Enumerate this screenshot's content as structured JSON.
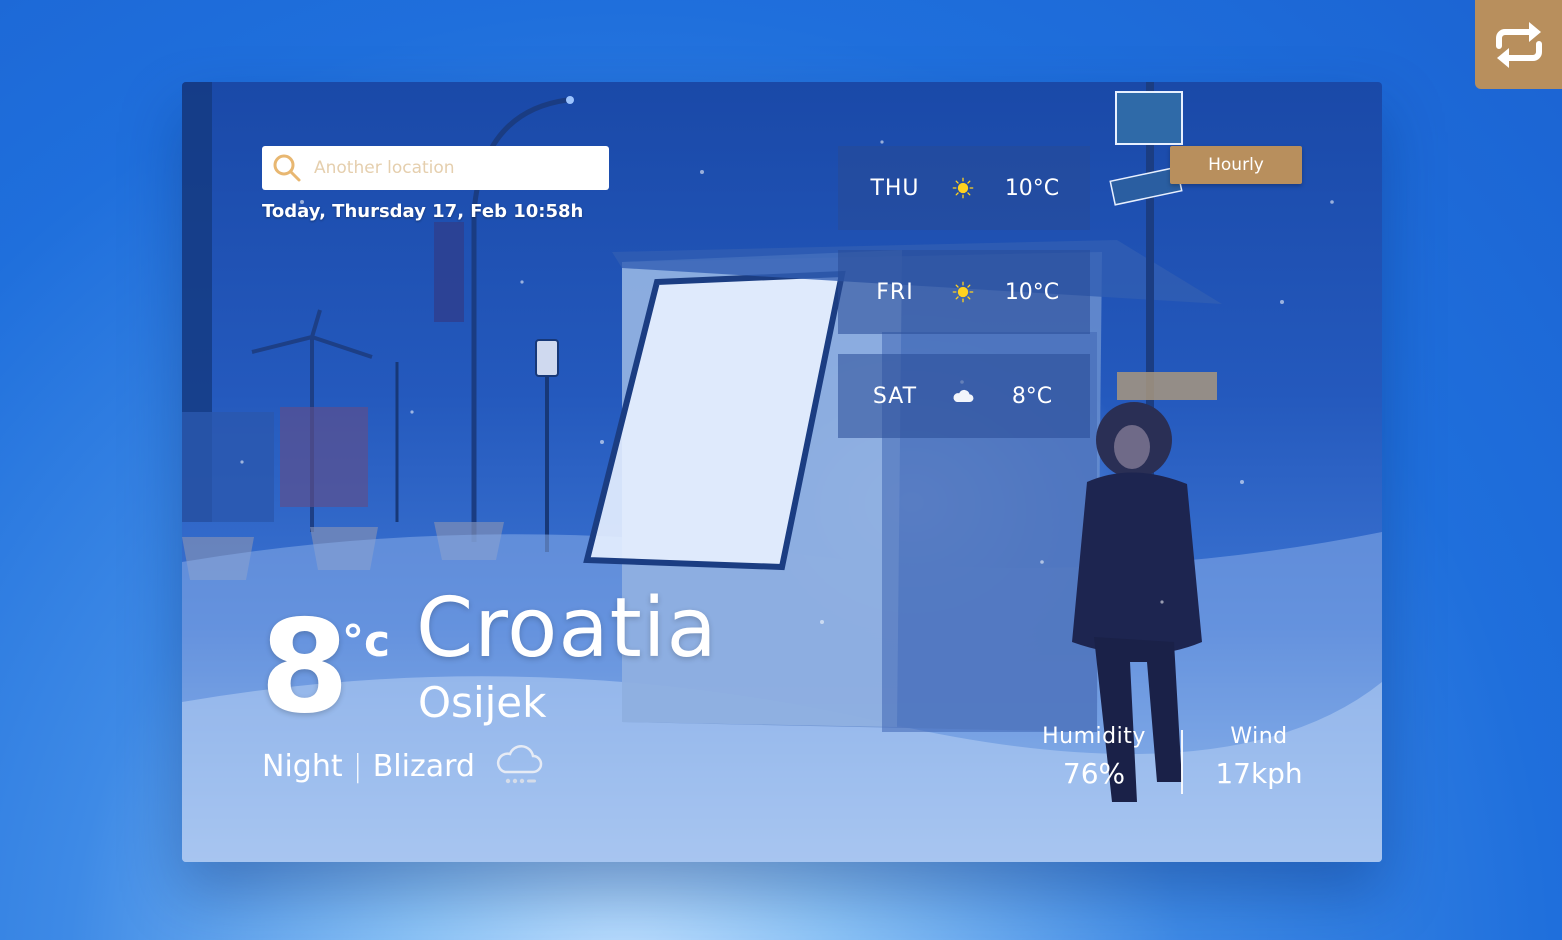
{
  "search": {
    "placeholder": "Another location"
  },
  "date_text": "Today, Thursday 17, Feb 10:58h",
  "forecast": [
    {
      "day": "THU",
      "icon": "sun-icon",
      "temp": "10°C"
    },
    {
      "day": "FRI",
      "icon": "sun-icon",
      "temp": "10°C"
    },
    {
      "day": "SAT",
      "icon": "cloud-icon",
      "temp": "8°C"
    }
  ],
  "hourly_label": "Hourly",
  "current": {
    "temp": "8",
    "unit": "°c",
    "country": "Croatia",
    "city": "Osijek",
    "period": "Night",
    "separator": "|",
    "condition": "Blizard",
    "condition_icon": "snow-cloud-icon"
  },
  "stats": {
    "humidity_label": "Humidity",
    "humidity_value": "76%",
    "wind_label": "Wind",
    "wind_value": "17kph"
  },
  "colors": {
    "accent": "#b88f5d",
    "background": "#1f6fdc",
    "sun": "#ffd21f"
  }
}
